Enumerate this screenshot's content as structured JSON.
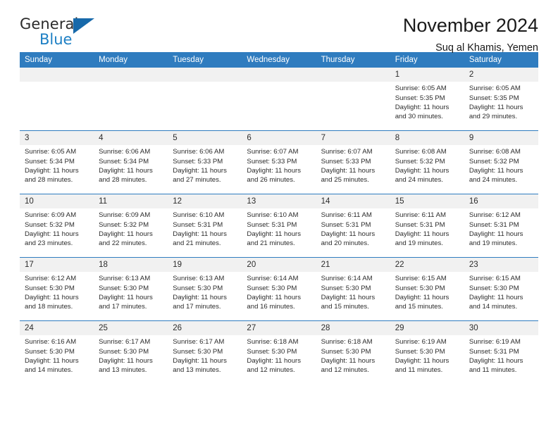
{
  "brand": {
    "name_part1": "General",
    "name_part2": "Blue",
    "logo_icon": "blue-triangle-icon"
  },
  "header": {
    "title": "November 2024",
    "subtitle": "Suq al Khamis, Yemen"
  },
  "colors": {
    "header_blue": "#2f7cbf",
    "brand_blue": "#1c7fc4",
    "daynum_band": "#f1f1f1"
  },
  "weekday_headers": [
    "Sunday",
    "Monday",
    "Tuesday",
    "Wednesday",
    "Thursday",
    "Friday",
    "Saturday"
  ],
  "weeks": [
    [
      {
        "day": "",
        "lines": []
      },
      {
        "day": "",
        "lines": []
      },
      {
        "day": "",
        "lines": []
      },
      {
        "day": "",
        "lines": []
      },
      {
        "day": "",
        "lines": []
      },
      {
        "day": "1",
        "lines": [
          "Sunrise: 6:05 AM",
          "Sunset: 5:35 PM",
          "Daylight: 11 hours",
          "and 30 minutes."
        ]
      },
      {
        "day": "2",
        "lines": [
          "Sunrise: 6:05 AM",
          "Sunset: 5:35 PM",
          "Daylight: 11 hours",
          "and 29 minutes."
        ]
      }
    ],
    [
      {
        "day": "3",
        "lines": [
          "Sunrise: 6:05 AM",
          "Sunset: 5:34 PM",
          "Daylight: 11 hours",
          "and 28 minutes."
        ]
      },
      {
        "day": "4",
        "lines": [
          "Sunrise: 6:06 AM",
          "Sunset: 5:34 PM",
          "Daylight: 11 hours",
          "and 28 minutes."
        ]
      },
      {
        "day": "5",
        "lines": [
          "Sunrise: 6:06 AM",
          "Sunset: 5:33 PM",
          "Daylight: 11 hours",
          "and 27 minutes."
        ]
      },
      {
        "day": "6",
        "lines": [
          "Sunrise: 6:07 AM",
          "Sunset: 5:33 PM",
          "Daylight: 11 hours",
          "and 26 minutes."
        ]
      },
      {
        "day": "7",
        "lines": [
          "Sunrise: 6:07 AM",
          "Sunset: 5:33 PM",
          "Daylight: 11 hours",
          "and 25 minutes."
        ]
      },
      {
        "day": "8",
        "lines": [
          "Sunrise: 6:08 AM",
          "Sunset: 5:32 PM",
          "Daylight: 11 hours",
          "and 24 minutes."
        ]
      },
      {
        "day": "9",
        "lines": [
          "Sunrise: 6:08 AM",
          "Sunset: 5:32 PM",
          "Daylight: 11 hours",
          "and 24 minutes."
        ]
      }
    ],
    [
      {
        "day": "10",
        "lines": [
          "Sunrise: 6:09 AM",
          "Sunset: 5:32 PM",
          "Daylight: 11 hours",
          "and 23 minutes."
        ]
      },
      {
        "day": "11",
        "lines": [
          "Sunrise: 6:09 AM",
          "Sunset: 5:32 PM",
          "Daylight: 11 hours",
          "and 22 minutes."
        ]
      },
      {
        "day": "12",
        "lines": [
          "Sunrise: 6:10 AM",
          "Sunset: 5:31 PM",
          "Daylight: 11 hours",
          "and 21 minutes."
        ]
      },
      {
        "day": "13",
        "lines": [
          "Sunrise: 6:10 AM",
          "Sunset: 5:31 PM",
          "Daylight: 11 hours",
          "and 21 minutes."
        ]
      },
      {
        "day": "14",
        "lines": [
          "Sunrise: 6:11 AM",
          "Sunset: 5:31 PM",
          "Daylight: 11 hours",
          "and 20 minutes."
        ]
      },
      {
        "day": "15",
        "lines": [
          "Sunrise: 6:11 AM",
          "Sunset: 5:31 PM",
          "Daylight: 11 hours",
          "and 19 minutes."
        ]
      },
      {
        "day": "16",
        "lines": [
          "Sunrise: 6:12 AM",
          "Sunset: 5:31 PM",
          "Daylight: 11 hours",
          "and 19 minutes."
        ]
      }
    ],
    [
      {
        "day": "17",
        "lines": [
          "Sunrise: 6:12 AM",
          "Sunset: 5:30 PM",
          "Daylight: 11 hours",
          "and 18 minutes."
        ]
      },
      {
        "day": "18",
        "lines": [
          "Sunrise: 6:13 AM",
          "Sunset: 5:30 PM",
          "Daylight: 11 hours",
          "and 17 minutes."
        ]
      },
      {
        "day": "19",
        "lines": [
          "Sunrise: 6:13 AM",
          "Sunset: 5:30 PM",
          "Daylight: 11 hours",
          "and 17 minutes."
        ]
      },
      {
        "day": "20",
        "lines": [
          "Sunrise: 6:14 AM",
          "Sunset: 5:30 PM",
          "Daylight: 11 hours",
          "and 16 minutes."
        ]
      },
      {
        "day": "21",
        "lines": [
          "Sunrise: 6:14 AM",
          "Sunset: 5:30 PM",
          "Daylight: 11 hours",
          "and 15 minutes."
        ]
      },
      {
        "day": "22",
        "lines": [
          "Sunrise: 6:15 AM",
          "Sunset: 5:30 PM",
          "Daylight: 11 hours",
          "and 15 minutes."
        ]
      },
      {
        "day": "23",
        "lines": [
          "Sunrise: 6:15 AM",
          "Sunset: 5:30 PM",
          "Daylight: 11 hours",
          "and 14 minutes."
        ]
      }
    ],
    [
      {
        "day": "24",
        "lines": [
          "Sunrise: 6:16 AM",
          "Sunset: 5:30 PM",
          "Daylight: 11 hours",
          "and 14 minutes."
        ]
      },
      {
        "day": "25",
        "lines": [
          "Sunrise: 6:17 AM",
          "Sunset: 5:30 PM",
          "Daylight: 11 hours",
          "and 13 minutes."
        ]
      },
      {
        "day": "26",
        "lines": [
          "Sunrise: 6:17 AM",
          "Sunset: 5:30 PM",
          "Daylight: 11 hours",
          "and 13 minutes."
        ]
      },
      {
        "day": "27",
        "lines": [
          "Sunrise: 6:18 AM",
          "Sunset: 5:30 PM",
          "Daylight: 11 hours",
          "and 12 minutes."
        ]
      },
      {
        "day": "28",
        "lines": [
          "Sunrise: 6:18 AM",
          "Sunset: 5:30 PM",
          "Daylight: 11 hours",
          "and 12 minutes."
        ]
      },
      {
        "day": "29",
        "lines": [
          "Sunrise: 6:19 AM",
          "Sunset: 5:30 PM",
          "Daylight: 11 hours",
          "and 11 minutes."
        ]
      },
      {
        "day": "30",
        "lines": [
          "Sunrise: 6:19 AM",
          "Sunset: 5:31 PM",
          "Daylight: 11 hours",
          "and 11 minutes."
        ]
      }
    ]
  ]
}
